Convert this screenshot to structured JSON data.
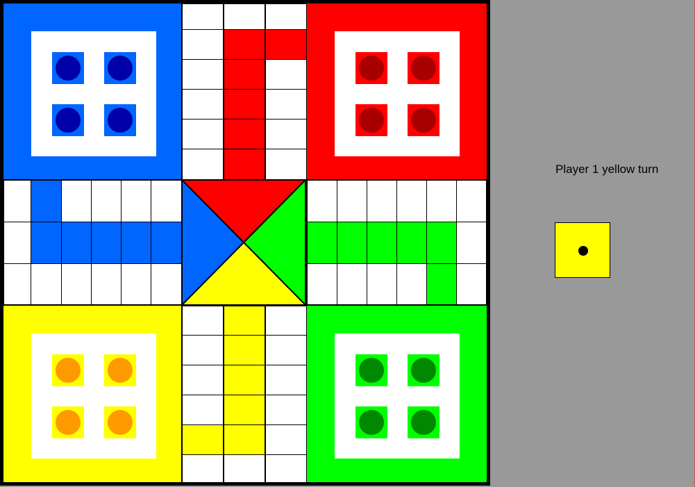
{
  "colors": {
    "blue": "#0066ff",
    "blue_token": "#0000a8",
    "red": "#ff0000",
    "red_token": "#a80000",
    "green": "#00ff00",
    "green_token": "#008800",
    "yellow": "#ffff00",
    "yellow_token": "#ff9900",
    "panel": "#999999"
  },
  "homes": [
    {
      "color": "blue",
      "pieces": 4
    },
    {
      "color": "red",
      "pieces": 4
    },
    {
      "color": "yellow",
      "pieces": 4
    },
    {
      "color": "green",
      "pieces": 4
    }
  ],
  "status": {
    "turn_text": "Player 1 yellow turn"
  },
  "dice": {
    "value": 1,
    "color": "#ffff00"
  }
}
